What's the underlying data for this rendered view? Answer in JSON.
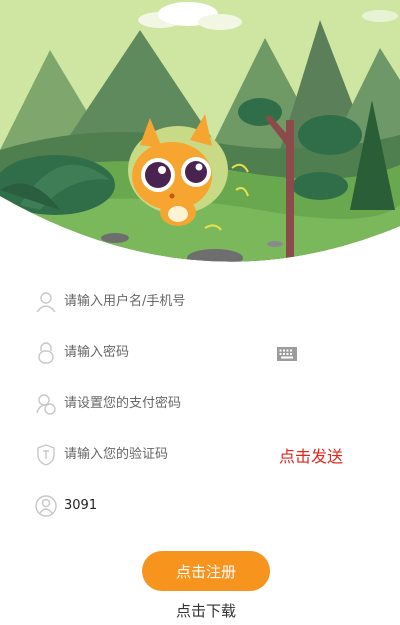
{
  "form": {
    "username_placeholder": "请输入用户名/手机号",
    "password_placeholder": "请输入密码",
    "pay_password_placeholder": "请设置您的支付密码",
    "code_placeholder": "请输入您的验证码",
    "send_code_label": "点击发送",
    "captcha_value": "3091"
  },
  "actions": {
    "register_label": "点击注册",
    "download_label": "点击下载"
  },
  "icons": {
    "username": "user-icon",
    "password": "lock-icon",
    "pay_password": "wallet-icon",
    "code": "shield-icon",
    "keyboard": "keyboard-icon",
    "captcha": "captcha-user-icon"
  },
  "colors": {
    "accent": "#f7941d",
    "send_code": "#e0251c",
    "sky": "#cfe6a2",
    "grass": "#6aa84f"
  }
}
